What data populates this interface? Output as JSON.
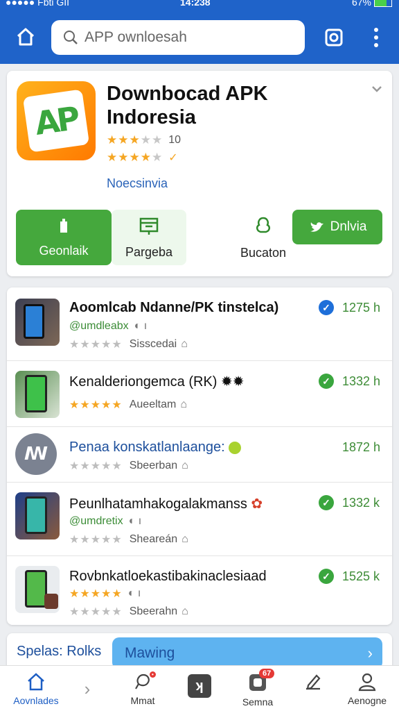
{
  "status_bar": {
    "carrier": "●●●●● Fbti GII",
    "time": "14:238",
    "battery": "67%"
  },
  "search": {
    "placeholder": "APP ownloesah"
  },
  "app": {
    "title": "Downbocad APK Indoresia",
    "rating_count": "10",
    "subtitle": "Noecsinvia",
    "actions": {
      "primary_label": "Geonlaik",
      "secondary_label": "Pargeba",
      "third_label": "Bucaton",
      "share_label": "Dnlvia"
    }
  },
  "list": [
    {
      "title": "Aoomlcab Ndanne/PK tinstelca)",
      "subtitle": "@umdleabx",
      "label": "Sisscedai",
      "size": "1275 h",
      "stars": 0,
      "check_color": "#1e6fd9"
    },
    {
      "title": "Kenalderiongemca (RK) ✹✹",
      "subtitle": "",
      "label": "Aueeltam",
      "size": "1332 h",
      "stars": 5,
      "check_color": "#3aa63e"
    },
    {
      "title": "Penaa konskatlanlaange:",
      "subtitle": "",
      "label": "Sbeerban",
      "size": "1872 h",
      "stars": 0,
      "check_color": ""
    },
    {
      "title": "Peunlhatamhakogalakmanss",
      "subtitle": "@umdretix",
      "label": "Sheareán",
      "size": "1332 k",
      "stars": 0,
      "check_color": "#3aa63e"
    },
    {
      "title": "Rovbnkatloekastibakinaclesiaad",
      "subtitle": "",
      "label": "Sbeerahn",
      "size": "1525 k",
      "stars": 5,
      "check_color": "#3aa63e"
    }
  ],
  "banner": {
    "label": "Spelas: Rolks",
    "button": "Mawing"
  },
  "bottom_nav": [
    {
      "label": "Aovnlades",
      "badge": ""
    },
    {
      "label": "Mmat",
      "badge": ""
    },
    {
      "label": "",
      "badge": ""
    },
    {
      "label": "Semna",
      "badge": "67"
    },
    {
      "label": "",
      "badge": ""
    },
    {
      "label": "Aenogne",
      "badge": ""
    }
  ],
  "colors": {
    "brand": "#1f63c9",
    "green": "#45a83d",
    "accent_blue": "#5eb3f0"
  }
}
